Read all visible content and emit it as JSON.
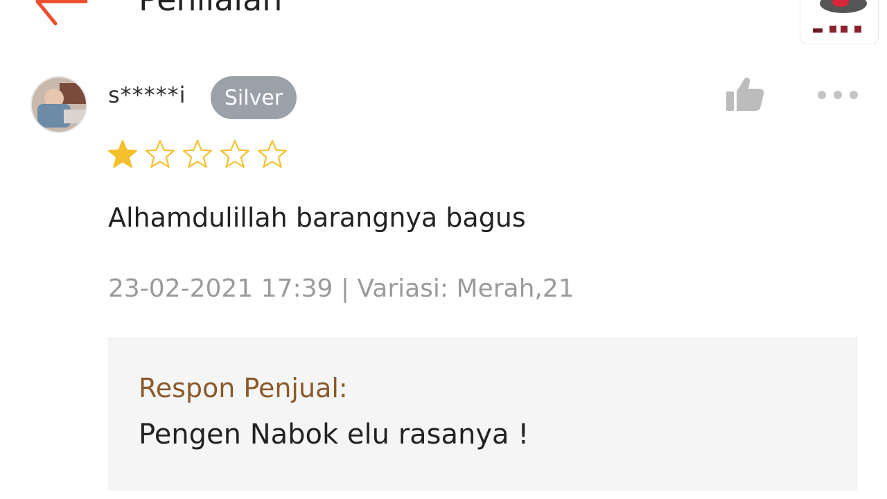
{
  "header": {
    "title": "Penilaian",
    "back_icon": "arrow-left-icon",
    "accent_color": "#ee4d2d"
  },
  "review": {
    "reviewer_name": "s*****i",
    "member_badge": "Silver",
    "rating": 1,
    "rating_max": 5,
    "star_color": "#f6c02d",
    "text": "Alhamdulillah barangnya bagus",
    "date": "23-02-2021 17:39",
    "separator": " | ",
    "variation": "Variasi: Merah,21",
    "like_icon": "thumbs-up-icon",
    "more_icon": "more-dots-icon"
  },
  "seller_response": {
    "label": "Respon Penjual:",
    "text": "Pengen Nabok elu rasanya !"
  }
}
